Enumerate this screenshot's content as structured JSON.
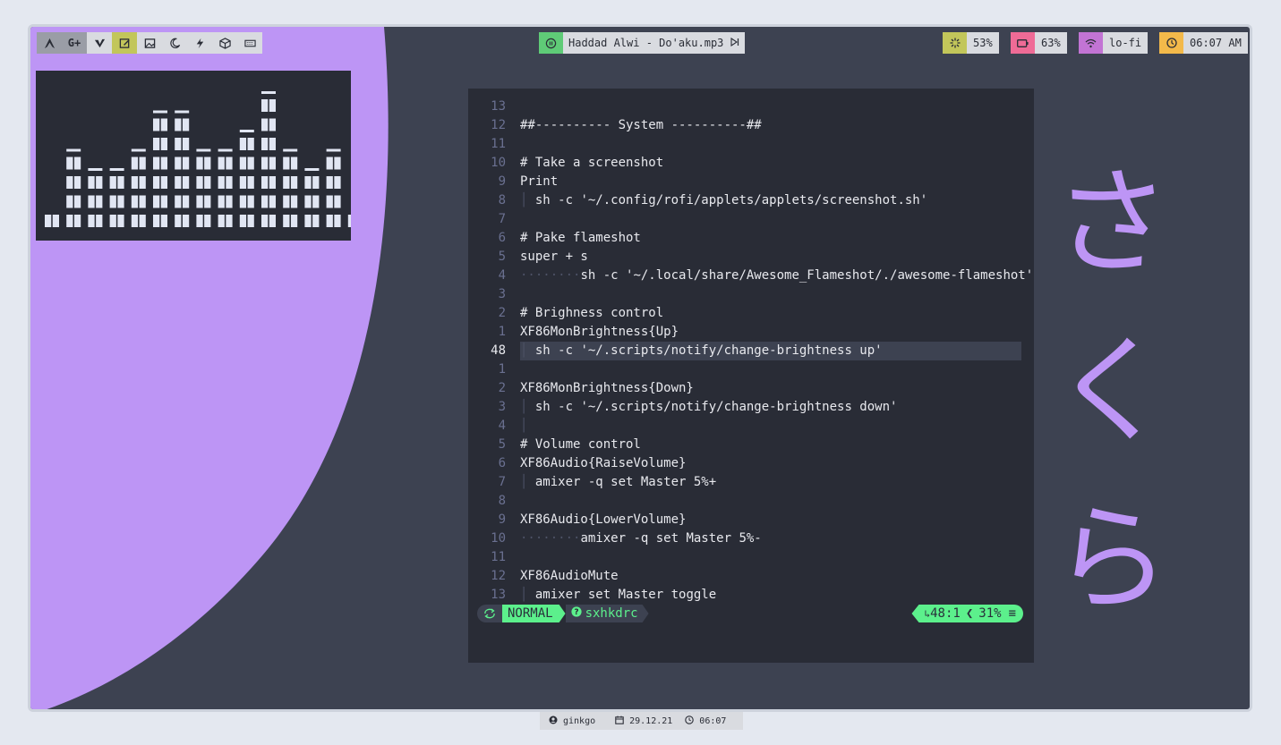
{
  "colors": {
    "frame_bg": "#3d4251",
    "purple": "#bd95f5",
    "panel_bg": "#292c36",
    "pill_bg": "#d9dbe0",
    "green": "#5fcb77",
    "mode_green": "#5cf08c",
    "cpu_yellow": "#c2c65a",
    "battery_pink": "#ef6b96",
    "wifi_purple": "#c274d4",
    "clock_orange": "#f3b94a"
  },
  "launcher": {
    "icons": [
      "arch-icon",
      "google-plus-icon",
      "vivaldi-icon",
      "notes-icon",
      "image-icon",
      "moon-icon",
      "zap-icon",
      "cube-icon",
      "keyboard-icon"
    ],
    "google_plus_label": "G+"
  },
  "music": {
    "icon": "pause-icon",
    "title": "Haddad Alwi - Do'aku.mp3",
    "next_icon": "skip-next-icon"
  },
  "status": {
    "cpu": {
      "icon": "cpu-icon",
      "value": "53%"
    },
    "battery": {
      "icon": "battery-icon",
      "value": "63%"
    },
    "wifi": {
      "icon": "wifi-icon",
      "value": "lo-fi"
    },
    "clock": {
      "icon": "clock-icon",
      "value": "06:07 AM"
    }
  },
  "visualizer": {
    "levels": [
      1,
      4,
      3,
      3,
      4,
      6,
      6,
      4,
      4,
      5,
      7,
      4,
      3,
      4,
      1
    ]
  },
  "editor": {
    "lines": [
      {
        "num": "13",
        "text": ""
      },
      {
        "num": "12",
        "text": "##---------- System ----------##"
      },
      {
        "num": "11",
        "text": ""
      },
      {
        "num": "10",
        "text": "# Take a screenshot"
      },
      {
        "num": "9",
        "text": "Print"
      },
      {
        "num": "8",
        "guide": "│",
        "text": "sh -c '~/.config/rofi/applets/applets/screenshot.sh'"
      },
      {
        "num": "7",
        "text": ""
      },
      {
        "num": "6",
        "text": "# Pake flameshot"
      },
      {
        "num": "5",
        "text": "super + s"
      },
      {
        "num": "4",
        "guide": "········",
        "text": "sh -c '~/.local/share/Awesome_Flameshot/./awesome-flameshot'"
      },
      {
        "num": "3",
        "text": ""
      },
      {
        "num": "2",
        "text": "# Brighness control"
      },
      {
        "num": "1",
        "text": "XF86MonBrightness{Up}"
      },
      {
        "num": "48",
        "guide": "│",
        "text": "sh -c '~/.scripts/notify/change-brightness up'",
        "current": true
      },
      {
        "num": "1",
        "text": ""
      },
      {
        "num": "2",
        "text": "XF86MonBrightness{Down}"
      },
      {
        "num": "3",
        "guide": "│",
        "text": "sh -c '~/.scripts/notify/change-brightness down'"
      },
      {
        "num": "4",
        "guide": "│",
        "text": ""
      },
      {
        "num": "5",
        "text": "# Volume control"
      },
      {
        "num": "6",
        "text": "XF86Audio{RaiseVolume}"
      },
      {
        "num": "7",
        "guide": "│",
        "text": "amixer -q set Master 5%+"
      },
      {
        "num": "8",
        "text": ""
      },
      {
        "num": "9",
        "text": "XF86Audio{LowerVolume}"
      },
      {
        "num": "10",
        "guide": "········",
        "text": "amixer -q set Master 5%-"
      },
      {
        "num": "11",
        "text": ""
      },
      {
        "num": "12",
        "text": "XF86AudioMute"
      },
      {
        "num": "13",
        "guide": "│",
        "text": "amixer set Master toggle"
      }
    ],
    "statusline": {
      "mode_icon": "sync-icon",
      "mode": "NORMAL",
      "file_icon": "question-icon",
      "filename": "sxhkdrc",
      "position": "48:1",
      "percent": "31%",
      "menu_icon": "≡"
    }
  },
  "sakura": [
    "さ",
    "く",
    "ら"
  ],
  "bottombar": {
    "user": {
      "icon": "user-icon",
      "value": "ginkgo"
    },
    "date": {
      "icon": "calendar-icon",
      "value": "29.12.21"
    },
    "time": {
      "icon": "clock-icon",
      "value": "06:07"
    }
  }
}
